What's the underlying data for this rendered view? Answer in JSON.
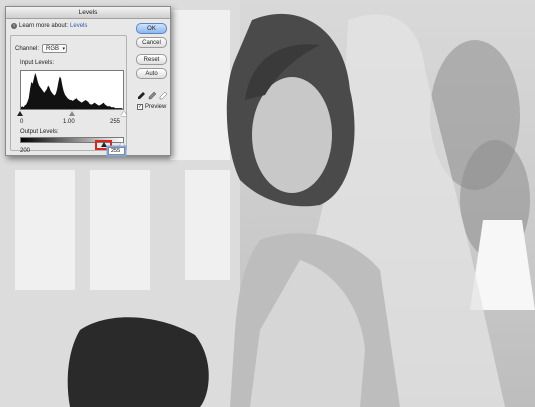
{
  "dialog": {
    "title": "Levels",
    "learn_text": "Learn more about:",
    "learn_link": "Levels",
    "channel_label": "Channel:",
    "channel_value": "RGB",
    "input_levels_label": "Input Levels:",
    "input_black": "0",
    "input_gamma": "1.00",
    "input_white": "255",
    "output_levels_label": "Output Levels:",
    "output_black": "200",
    "output_white": "255",
    "buttons": {
      "ok": "OK",
      "cancel": "Cancel",
      "reset": "Reset",
      "auto": "Auto"
    },
    "preview_label": "Preview",
    "preview_checked": true,
    "histogram_values": [
      2,
      3,
      2,
      4,
      5,
      8,
      12,
      22,
      30,
      28,
      34,
      40,
      36,
      30,
      26,
      24,
      22,
      20,
      18,
      20,
      22,
      26,
      24,
      20,
      18,
      16,
      15,
      17,
      22,
      30,
      36,
      34,
      26,
      20,
      16,
      14,
      12,
      11,
      10,
      10,
      9,
      10,
      11,
      12,
      10,
      9,
      8,
      7,
      8,
      9,
      10,
      9,
      8,
      6,
      5,
      5,
      6,
      7,
      6,
      5,
      4,
      4,
      5,
      6,
      7,
      5,
      4,
      3,
      3,
      3,
      2,
      2,
      2,
      1,
      1,
      1,
      1,
      1,
      1,
      0
    ]
  },
  "colors": {
    "accent": "#d8281b",
    "link": "#2a5db0",
    "ok_button": "#8cb7ef"
  }
}
